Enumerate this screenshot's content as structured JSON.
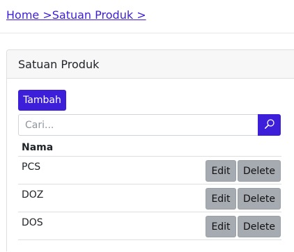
{
  "breadcrumb": {
    "home": "Home >",
    "current": "Satuan Produk >"
  },
  "card": {
    "title": "Satuan Produk"
  },
  "toolbar": {
    "add_label": "Tambah"
  },
  "search": {
    "placeholder": "Cari...",
    "value": "",
    "icon": "search-icon"
  },
  "table": {
    "columns": [
      "Nama"
    ],
    "rows": [
      {
        "name": "PCS",
        "edit_label": "Edit",
        "delete_label": "Delete"
      },
      {
        "name": "DOZ",
        "edit_label": "Edit",
        "delete_label": "Delete"
      },
      {
        "name": "DOS",
        "edit_label": "Edit",
        "delete_label": "Delete"
      }
    ]
  },
  "colors": {
    "primary": "#3d1fd9",
    "link": "#3b1fd8",
    "secondary_button": "#a6abb2"
  }
}
